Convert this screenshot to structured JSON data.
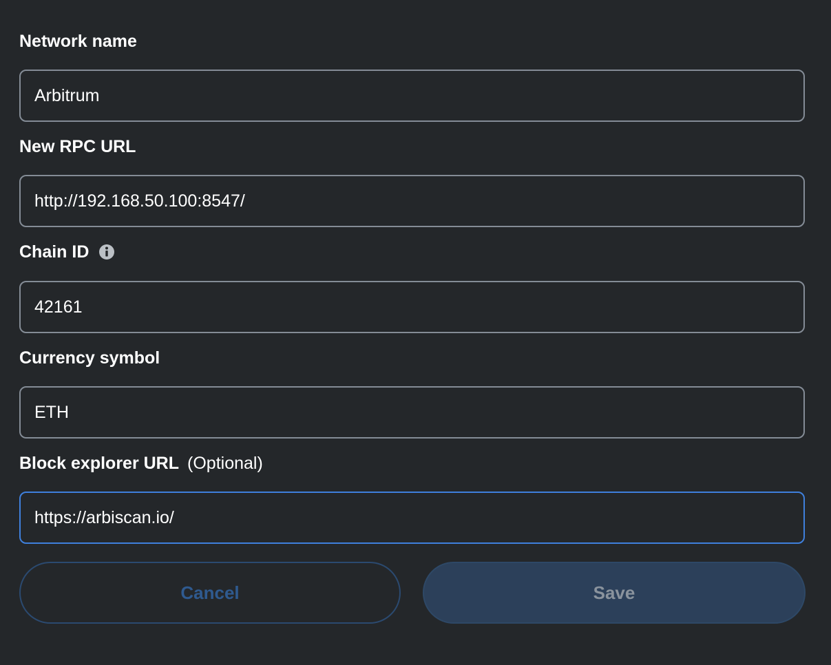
{
  "fields": [
    {
      "label": "Network name",
      "value": "Arbitrum"
    },
    {
      "label": "New RPC URL",
      "value": "http://192.168.50.100:8547/"
    },
    {
      "label": "Chain ID",
      "value": "42161",
      "has_info_icon": true
    },
    {
      "label": "Currency symbol",
      "value": "ETH"
    },
    {
      "label": "Block explorer URL",
      "optional_label": "(Optional)",
      "value": "https://arbiscan.io/",
      "focused": true
    }
  ],
  "buttons": {
    "cancel_label": "Cancel",
    "save_label": "Save"
  },
  "icons": {
    "info": "info-icon"
  },
  "colors": {
    "background": "#24272a",
    "input_border": "#848c96",
    "focused_border": "#3f80dd",
    "cancel_text": "#2f5a8f",
    "save_bg": "#2c405a",
    "save_text": "#8a939d"
  }
}
